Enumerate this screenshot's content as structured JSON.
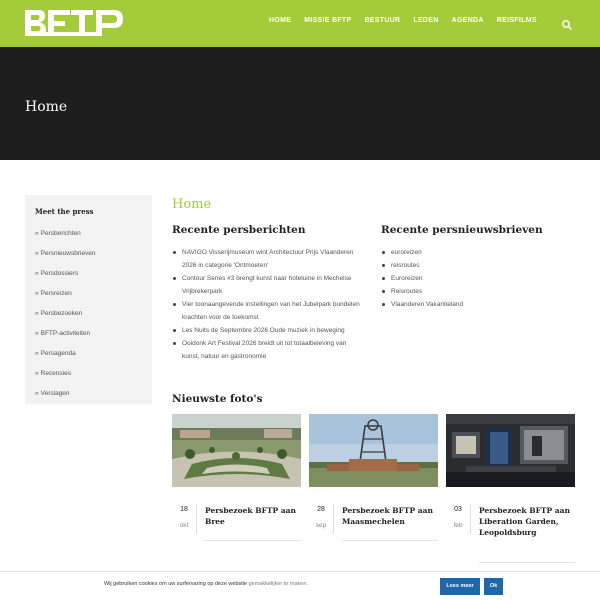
{
  "header": {
    "logo_text": "BFTP",
    "nav": [
      "HOME",
      "MISSIE BFTP",
      "BESTUUR",
      "LEDEN",
      "AGENDA",
      "REISFILMS"
    ],
    "search_icon": "search-icon"
  },
  "hero": {
    "title": "Home"
  },
  "sidebar": {
    "heading": "Meet the press",
    "items": [
      "Persberichten",
      "Persnieuwsbrieven",
      "Persdossiers",
      "Persreizen",
      "Persbezoeken",
      "BFTP-activiteiten",
      "Persagenda",
      "Recensies",
      "Verslagen"
    ]
  },
  "main": {
    "title": "Home",
    "press_releases": {
      "heading": "Recente persberichten",
      "items": [
        "NAVIGO Visserijmuseum wint Architectuur Prijs Vlaanderen 2026 in categorie 'Ontmoeten'",
        "Contour Series #3 brengt kunst naar hoteluine in Mechelse Vrijbrekerpark",
        "Vier toonaangevende instellingen van het Jubelpark bundelen krachten voor de toekomst",
        "Les Nuits de Septembre 2026 Oude muziek in beweging",
        "Ooidonk Art Festival 2026 breidt uit tot totaalbeleving van kunst, natuur en gastronomie"
      ]
    },
    "newsletters": {
      "heading": "Recente persnieuwsbrieven",
      "items": [
        "euroreizen",
        "reisroutes",
        "Euroreizen",
        "Reisroutes",
        "Vlaanderen Vakantieland"
      ]
    },
    "photos": {
      "heading": "Nieuwste foto's",
      "cards": [
        {
          "day": "18",
          "month": "okt",
          "title": "Persbezoek BFTP aan Bree"
        },
        {
          "day": "28",
          "month": "sep",
          "title": "Persbezoek BFTP aan Maasmechelen"
        },
        {
          "day": "03",
          "month": "feb",
          "title": "Persbezoek BFTP aan Liberation Garden, Leopoldsburg"
        }
      ]
    }
  },
  "cookie": {
    "text": "Wij gebruiken cookies om uw surfervaring op deze website ",
    "link": "gemakkelijker te maken.",
    "more_button": "Lees meer",
    "ok_button": "Ok"
  },
  "colors": {
    "brand_green": "#a4cb3a",
    "hero_dark": "#1d1d1d",
    "button_blue": "#1f67a8"
  }
}
